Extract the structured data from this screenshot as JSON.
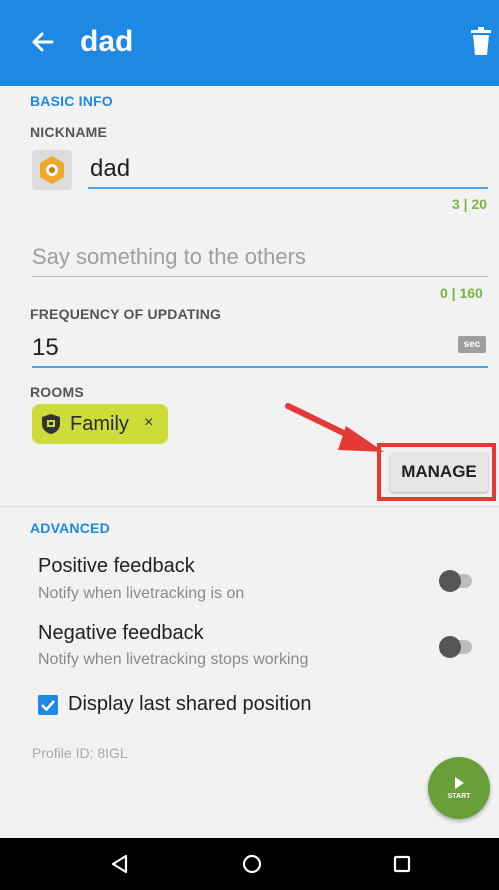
{
  "appbar": {
    "title": "dad"
  },
  "basic_info": {
    "section_title": "BASIC INFO",
    "nickname_label": "NICKNAME",
    "nickname_value": "dad",
    "nickname_counter": "3 | 20",
    "message_placeholder": "Say something to the others",
    "message_counter": "0 | 160",
    "frequency_label": "FREQUENCY OF UPDATING",
    "frequency_value": "15",
    "frequency_unit": "sec",
    "rooms_label": "ROOMS",
    "rooms": [
      {
        "name": "Family",
        "remove": "×"
      }
    ],
    "manage_label": "MANAGE"
  },
  "advanced": {
    "section_title": "ADVANCED",
    "settings": [
      {
        "title": "Positive feedback",
        "subtitle": "Notify when livetracking is on",
        "enabled": false
      },
      {
        "title": "Negative feedback",
        "subtitle": "Notify when livetracking stops working",
        "enabled": false
      }
    ],
    "display_last_position": {
      "label": "Display last shared position",
      "checked": true
    }
  },
  "profile_id": "Profile ID: 8IGL",
  "fab": {
    "label": "START",
    "icon": "play-icon"
  },
  "colors": {
    "primary": "#1e88e5",
    "accent_green": "#7cb342",
    "chip": "#cddc39",
    "fab": "#689f38",
    "highlight": "#e53935"
  },
  "navbar": {
    "icons": [
      "back-triangle-icon",
      "home-circle-icon",
      "recents-square-icon"
    ]
  }
}
